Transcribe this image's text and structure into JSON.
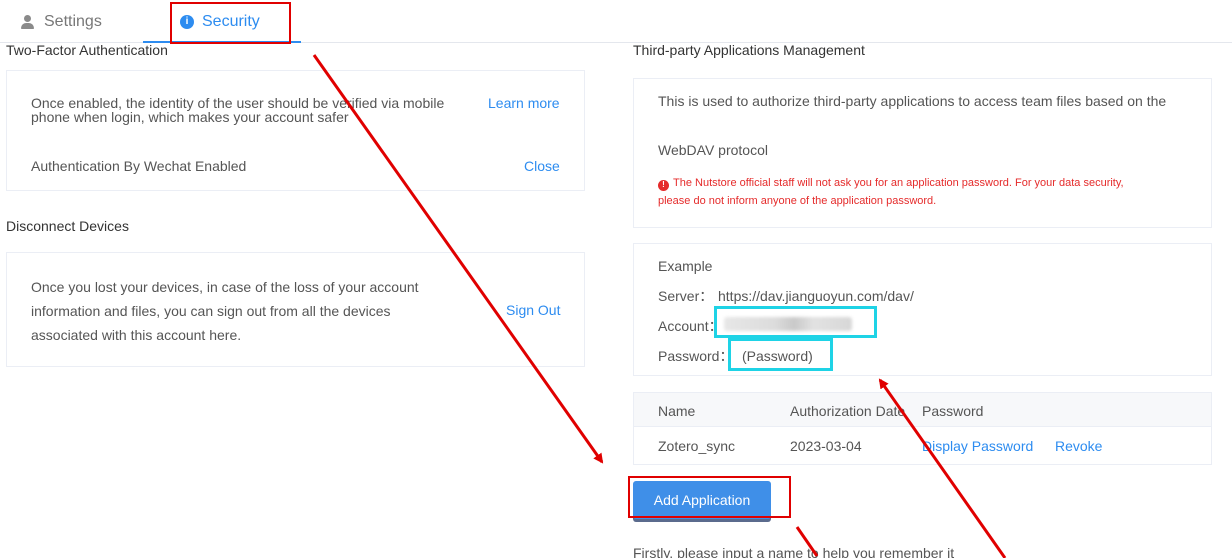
{
  "tabs": [
    {
      "label": "Settings",
      "icon": "user-icon"
    },
    {
      "label": "Security",
      "icon": "info-icon",
      "active": true
    }
  ],
  "two_factor": {
    "title": "Two-Factor Authentication",
    "line1": "Once enabled, the identity of the user should be verified via mobile",
    "line2": "phone when login, which makes your account safer",
    "learn_more": "Learn more",
    "wechat_label": "Authentication By Wechat Enabled",
    "close": "Close"
  },
  "disconnect": {
    "title": "Disconnect Devices",
    "line1": "Once you lost your devices, in case of the loss of your account",
    "line2": "information and files, you can sign out from all the devices",
    "line3": "associated with this account here.",
    "sign_out": "Sign Out"
  },
  "third_party": {
    "title": "Third-party Applications Management",
    "desc1": "This is used to authorize third-party applications to access team files based on the",
    "desc2": "WebDAV protocol",
    "warning1": "The Nutstore official staff will not ask you for an application password. For your data security,",
    "warning2": "please do not inform anyone of the application password.",
    "example_title": "Example",
    "server_label": "Server：",
    "server_value": "https://dav.jianguoyun.com/dav/",
    "account_label": "Account：",
    "password_label": "Password：",
    "password_value": "(Password)",
    "table": {
      "headers": [
        "Name",
        "Authorization Date",
        "Password"
      ],
      "rows": [
        {
          "name": "Zotero_sync",
          "date": "2023-03-04",
          "display": "Display Password",
          "revoke": "Revoke"
        }
      ]
    },
    "add_button": "Add Application",
    "hint": "Firstly, please input a name to help you remember it"
  },
  "colors": {
    "accent": "#2d8cf0",
    "button": "#3f8fe8",
    "warning": "#e52b2b",
    "annotation_red": "#e00000",
    "annotation_cyan": "#1ed3e6"
  }
}
